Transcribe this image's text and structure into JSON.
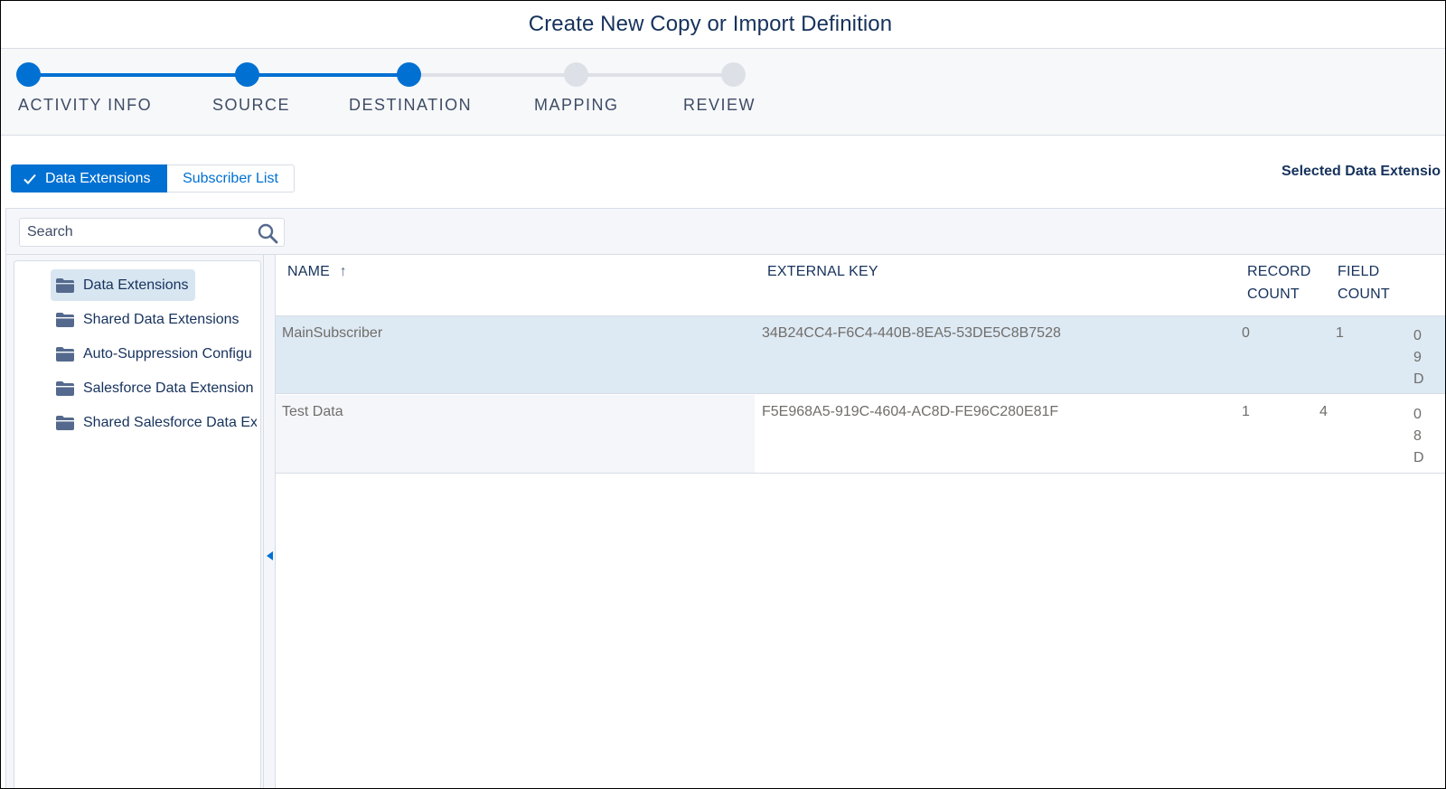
{
  "header": {
    "title": "Create New Copy or Import Definition"
  },
  "progress": {
    "steps": [
      {
        "label": "ACTIVITY INFO",
        "state": "done"
      },
      {
        "label": "SOURCE",
        "state": "done"
      },
      {
        "label": "DESTINATION",
        "state": "current"
      },
      {
        "label": "MAPPING",
        "state": "todo"
      },
      {
        "label": "REVIEW",
        "state": "todo"
      }
    ]
  },
  "toggle": {
    "data_extensions_label": "Data Extensions",
    "subscriber_list_label": "Subscriber List"
  },
  "selected_label": "Selected Data Extensio",
  "search": {
    "placeholder": "Search"
  },
  "tree": {
    "items": [
      {
        "label": "Data Extensions",
        "selected": true
      },
      {
        "label": "Shared Data Extensions",
        "selected": false
      },
      {
        "label": "Auto-Suppression Configu",
        "selected": false
      },
      {
        "label": "Salesforce Data Extension",
        "selected": false
      },
      {
        "label": "Shared Salesforce Data Ex",
        "selected": false
      }
    ]
  },
  "table": {
    "headers": {
      "name": "NAME",
      "sort_arrow": "↑",
      "external_key": "EXTERNAL KEY",
      "record_count_1": "RECORD",
      "record_count_2": "COUNT",
      "field_count_1": "FIELD",
      "field_count_2": "COUNT"
    },
    "rows": [
      {
        "name": "MainSubscriber",
        "external_key": "34B24CC4-F6C4-440B-8EA5-53DE5C8B7528",
        "record_count": "0",
        "field_count": "1",
        "extra": [
          "0",
          "9",
          "D"
        ]
      },
      {
        "name": "Test Data",
        "external_key": "F5E968A5-919C-4604-AC8D-FE96C280E81F",
        "record_count": "1",
        "field_count": "4",
        "extra": [
          "0",
          "8",
          "D"
        ]
      }
    ]
  },
  "colors": {
    "brand_blue": "#0070d2",
    "selected_row": "#dde9f3",
    "text_dark": "#16325c"
  }
}
